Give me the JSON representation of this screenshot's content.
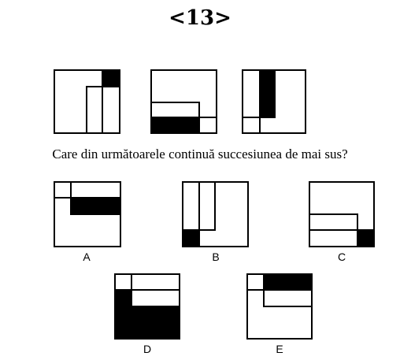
{
  "title": "<13>",
  "question": "Care din următoarele continuă succesiunea de mai sus?",
  "options": {
    "a": "A",
    "b": "B",
    "c": "C",
    "d": "D",
    "e": "E"
  },
  "colors": {
    "ink": "#000000",
    "paper": "#ffffff"
  }
}
